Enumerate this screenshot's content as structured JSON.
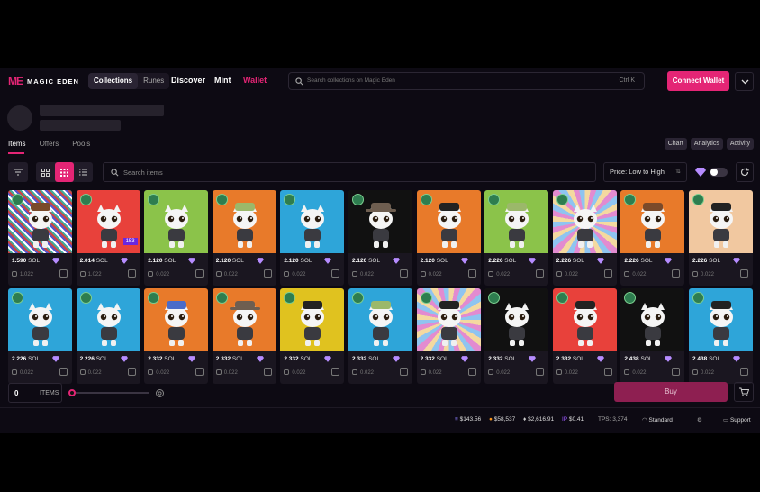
{
  "brand": {
    "logo_mark": "ME",
    "name": "MAGIC EDEN",
    "accent": "#e42575"
  },
  "nav": {
    "tabs": [
      {
        "label": "Collections",
        "active": true
      },
      {
        "label": "Runes",
        "active": false
      }
    ],
    "links": [
      "Discover",
      "Mint",
      "Wallet"
    ],
    "search_placeholder": "Search collections on Magic Eden",
    "search_shortcut": "Ctrl K",
    "connect_label": "Connect Wallet"
  },
  "collection_tabs": {
    "items": [
      "Items",
      "Offers",
      "Pools"
    ],
    "active": "Items"
  },
  "right_tabs": [
    "Chart",
    "Analytics",
    "Activity"
  ],
  "toolbar": {
    "search_placeholder": "Search items",
    "sort_label": "Price: Low to High",
    "icons": [
      "filter-icon",
      "grid-large-icon",
      "grid-small-icon",
      "list-icon",
      "gem-icon",
      "refresh-icon"
    ]
  },
  "items": [
    {
      "price": "1.590",
      "unit": "SOL",
      "sub": "1.022",
      "bg": "noise",
      "hat": "brown",
      "count": ""
    },
    {
      "price": "2.014",
      "unit": "SOL",
      "sub": "1.022",
      "bg": "#e8413b",
      "hat": "",
      "count": "153"
    },
    {
      "price": "2.120",
      "unit": "SOL",
      "sub": "0.022",
      "bg": "#8bc34a",
      "hat": "",
      "count": ""
    },
    {
      "price": "2.120",
      "unit": "SOL",
      "sub": "0.022",
      "bg": "#e87a2a",
      "hat": "green",
      "count": ""
    },
    {
      "price": "2.120",
      "unit": "SOL",
      "sub": "0.022",
      "bg": "#2ea5d9",
      "hat": "",
      "count": ""
    },
    {
      "price": "2.120",
      "unit": "SOL",
      "sub": "0.022",
      "bg": "#111",
      "hat": "cowboy",
      "count": ""
    },
    {
      "price": "2.120",
      "unit": "SOL",
      "sub": "0.022",
      "bg": "#e87a2a",
      "hat": "black",
      "count": ""
    },
    {
      "price": "2.226",
      "unit": "SOL",
      "sub": "0.022",
      "bg": "#8bc34a",
      "hat": "green",
      "count": ""
    },
    {
      "price": "2.226",
      "unit": "SOL",
      "sub": "0.022",
      "bg": "rays",
      "hat": "",
      "count": ""
    },
    {
      "price": "2.226",
      "unit": "SOL",
      "sub": "0.022",
      "bg": "#e87a2a",
      "hat": "brown",
      "count": ""
    },
    {
      "price": "2.226",
      "unit": "SOL",
      "sub": "0.022",
      "bg": "#f1c8a0",
      "hat": "black",
      "count": ""
    },
    {
      "price": "2.226",
      "unit": "SOL",
      "sub": "0.022",
      "bg": "#2ea5d9",
      "hat": "",
      "count": ""
    },
    {
      "price": "2.226",
      "unit": "SOL",
      "sub": "0.022",
      "bg": "#2ea5d9",
      "hat": "",
      "count": ""
    },
    {
      "price": "2.332",
      "unit": "SOL",
      "sub": "0.022",
      "bg": "#e87a2a",
      "hat": "blue",
      "count": ""
    },
    {
      "price": "2.332",
      "unit": "SOL",
      "sub": "0.022",
      "bg": "#e87a2a",
      "hat": "cowboy",
      "count": ""
    },
    {
      "price": "2.332",
      "unit": "SOL",
      "sub": "0.022",
      "bg": "#e0c21f",
      "hat": "black",
      "count": ""
    },
    {
      "price": "2.332",
      "unit": "SOL",
      "sub": "0.022",
      "bg": "#2ea5d9",
      "hat": "green",
      "count": ""
    },
    {
      "price": "2.332",
      "unit": "SOL",
      "sub": "0.022",
      "bg": "rays",
      "hat": "black",
      "count": ""
    },
    {
      "price": "2.332",
      "unit": "SOL",
      "sub": "0.022",
      "bg": "#111",
      "hat": "",
      "count": ""
    },
    {
      "price": "2.332",
      "unit": "SOL",
      "sub": "0.022",
      "bg": "#e8413b",
      "hat": "black",
      "count": ""
    },
    {
      "price": "2.438",
      "unit": "SOL",
      "sub": "0.022",
      "bg": "#111",
      "hat": "",
      "count": ""
    },
    {
      "price": "2.438",
      "unit": "SOL",
      "sub": "0.022",
      "bg": "#2ea5d9",
      "hat": "black",
      "count": ""
    }
  ],
  "cart": {
    "qty": "0",
    "qty_label": "ITEMS",
    "buy_label": "Buy"
  },
  "footer": {
    "tickers": [
      {
        "symbol": "≡",
        "value": "$143.56",
        "color": "#8a7cff"
      },
      {
        "symbol": "●",
        "value": "$58,537",
        "color": "#f7931a"
      },
      {
        "symbol": "♦",
        "value": "$2,616.91",
        "color": "#cccccc"
      },
      {
        "symbol": "IP",
        "value": "$0.41",
        "color": "#9b59ff"
      }
    ],
    "tps": "TPS: 3,374",
    "mode": "Standard",
    "support": "Support"
  }
}
